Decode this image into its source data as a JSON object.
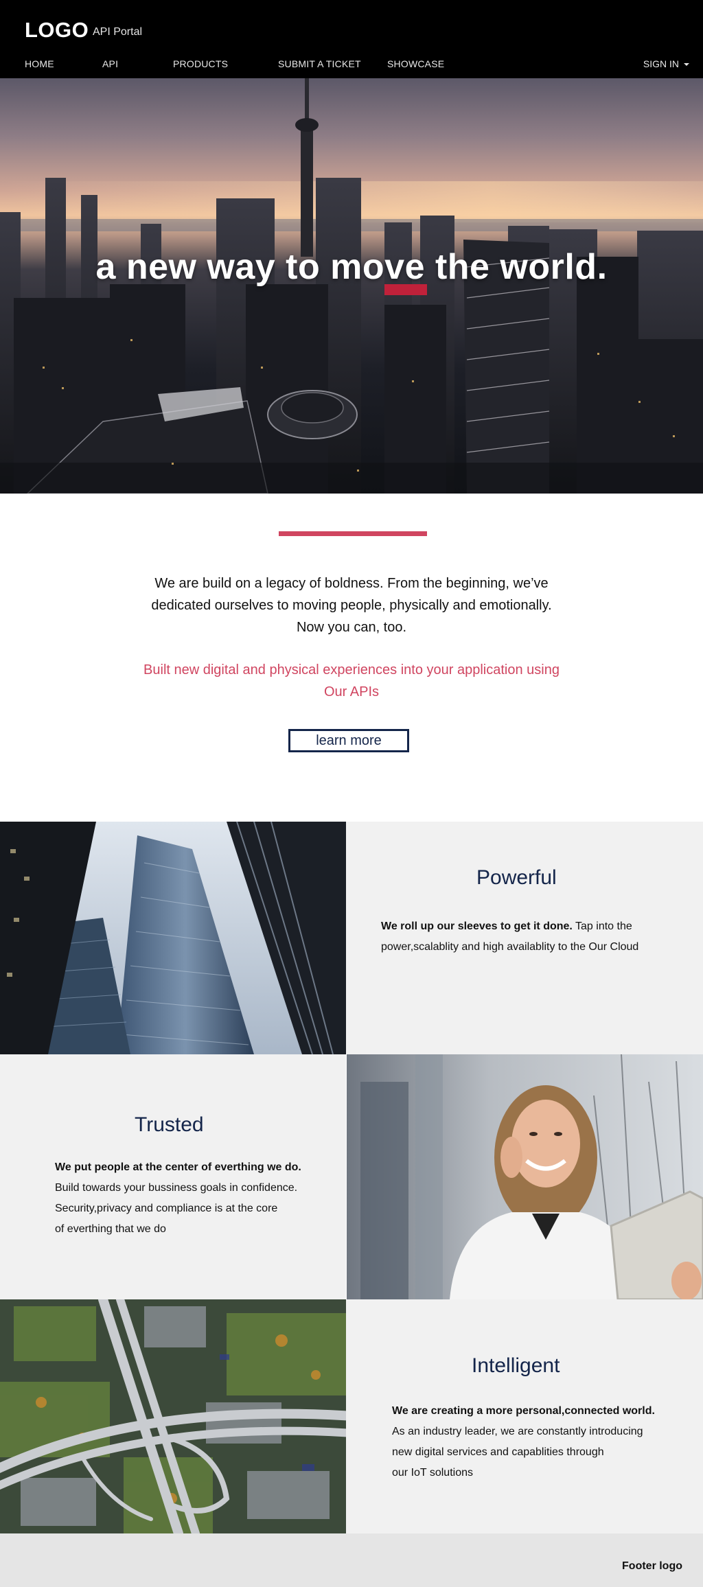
{
  "header": {
    "logo": "LOGO",
    "portal_label": "API Portal",
    "nav": [
      "HOME",
      "API",
      "PRODUCTS",
      "SUBMIT A TICKET",
      "SHOWCASE"
    ],
    "sign_in": "SIGN IN"
  },
  "hero": {
    "headline": "a new way to move the world."
  },
  "intro": {
    "lines": [
      "We are build on a legacy of boldness. From the beginning, we’ve",
      "dedicated ourselves to moving people, physically and emotionally.",
      "Now you can, too."
    ],
    "highlight_lines": [
      "Built new digital and physical experiences into your application using",
      "Our APIs"
    ],
    "button": "learn more"
  },
  "features": [
    {
      "title": "Powerful",
      "lead": "We roll up our sleeves to get it done.",
      "lead_rest": " Tap into the",
      "lines": [
        "power,scalablity and high availablity to the Our Cloud"
      ]
    },
    {
      "title": "Trusted",
      "lead": "We put people at the center of everthing we do.",
      "lead_rest": "",
      "lines": [
        "Build towards your bussiness goals in confidence.",
        "Security,privacy and compliance is at the core",
        "of everthing that we do"
      ]
    },
    {
      "title": "Intelligent",
      "lead": "We are creating a more personal,connected world.",
      "lead_rest": "",
      "lines": [
        "As an industry leader, we are constantly introducing",
        "new digital services  and capablities through",
        "our IoT solutions"
      ]
    }
  ],
  "footer": {
    "logo": "Footer logo"
  },
  "colors": {
    "header_bg": "#000000",
    "accent": "#d04560",
    "navy": "#14254a",
    "panel_bg": "#f1f1f1",
    "footer_bg": "#e5e5e5"
  }
}
